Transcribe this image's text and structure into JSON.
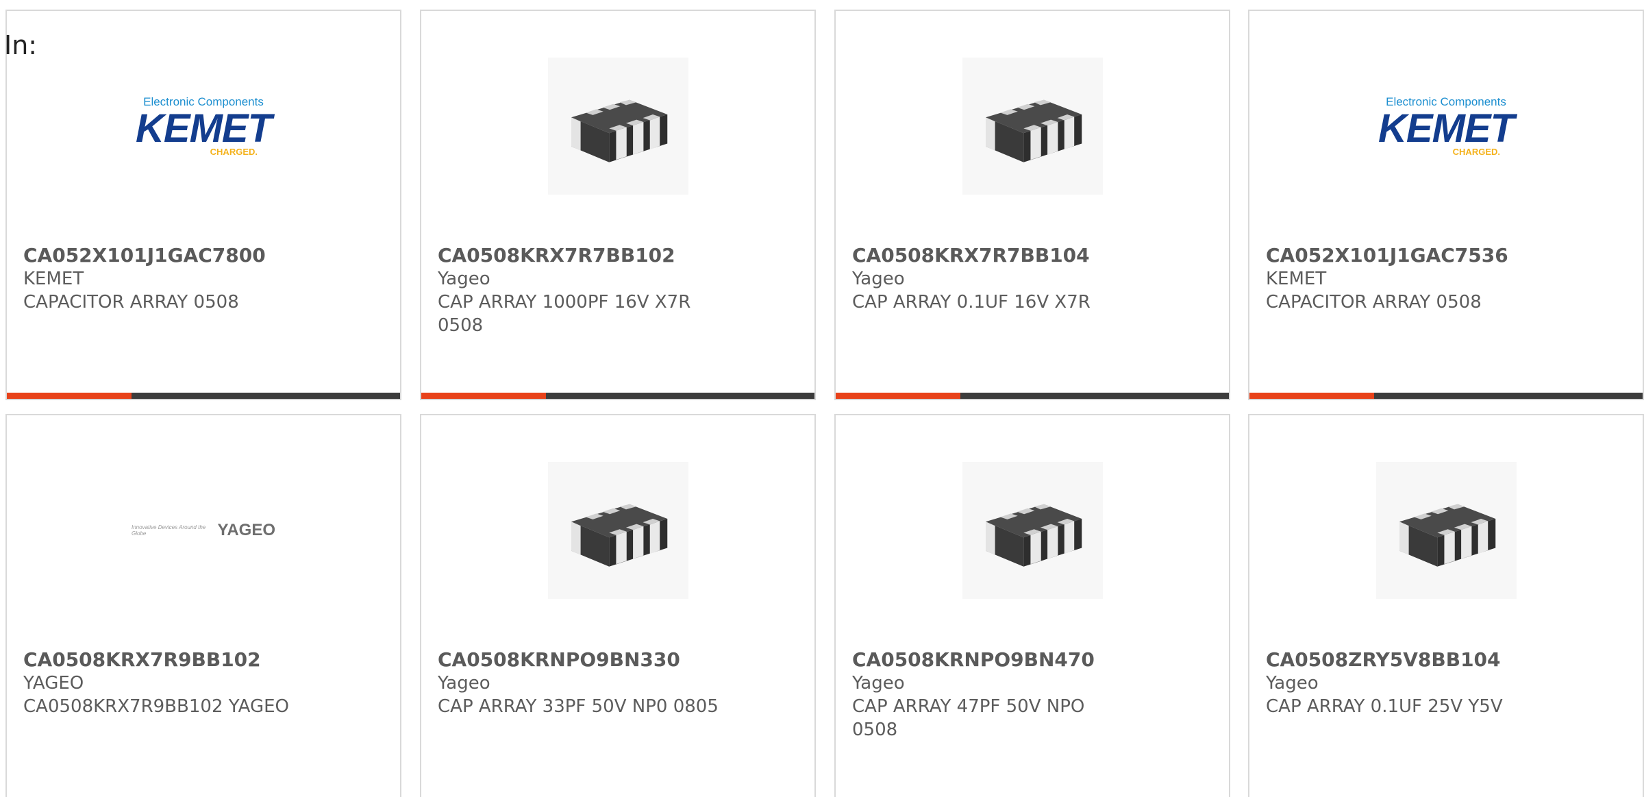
{
  "header": {
    "in_label": "In:"
  },
  "colors": {
    "accent": "#e8421a",
    "bar_dark": "#3c3c3c",
    "border": "#d9d9d9",
    "text": "#5c5c5c"
  },
  "accent_progress": 0.317,
  "logos": {
    "kemet": {
      "tagline": "Electronic Components",
      "wordmark": "KEMET",
      "slogan": "CHARGED."
    },
    "yageo": {
      "tagline": "Innovative Devices Around the Globe",
      "wordmark": "YAGEO"
    }
  },
  "cards": [
    {
      "image": "kemet-logo",
      "part_number": "CA052X101J1GAC7800",
      "manufacturer": "KEMET",
      "description": "CAPACITOR ARRAY 0508"
    },
    {
      "image": "chip-array-icon",
      "part_number": "CA0508KRX7R7BB102",
      "manufacturer": "Yageo",
      "description": "CAP ARRAY 1000PF 16V X7R 0508"
    },
    {
      "image": "chip-array-icon",
      "part_number": "CA0508KRX7R7BB104",
      "manufacturer": "Yageo",
      "description": "CAP ARRAY 0.1UF 16V X7R"
    },
    {
      "image": "kemet-logo",
      "part_number": "CA052X101J1GAC7536",
      "manufacturer": "KEMET",
      "description": "CAPACITOR ARRAY 0508"
    },
    {
      "image": "yageo-logo",
      "part_number": "CA0508KRX7R9BB102",
      "manufacturer": "YAGEO",
      "description": "CA0508KRX7R9BB102 YAGEO"
    },
    {
      "image": "chip-array-icon",
      "part_number": "CA0508KRNPO9BN330",
      "manufacturer": "Yageo",
      "description": "CAP ARRAY 33PF 50V NP0 0805"
    },
    {
      "image": "chip-array-icon",
      "part_number": "CA0508KRNPO9BN470",
      "manufacturer": "Yageo",
      "description": "CAP ARRAY 47PF 50V NPO 0508"
    },
    {
      "image": "chip-array-icon",
      "part_number": "CA0508ZRY5V8BB104",
      "manufacturer": "Yageo",
      "description": "CAP ARRAY 0.1UF 25V Y5V"
    }
  ]
}
